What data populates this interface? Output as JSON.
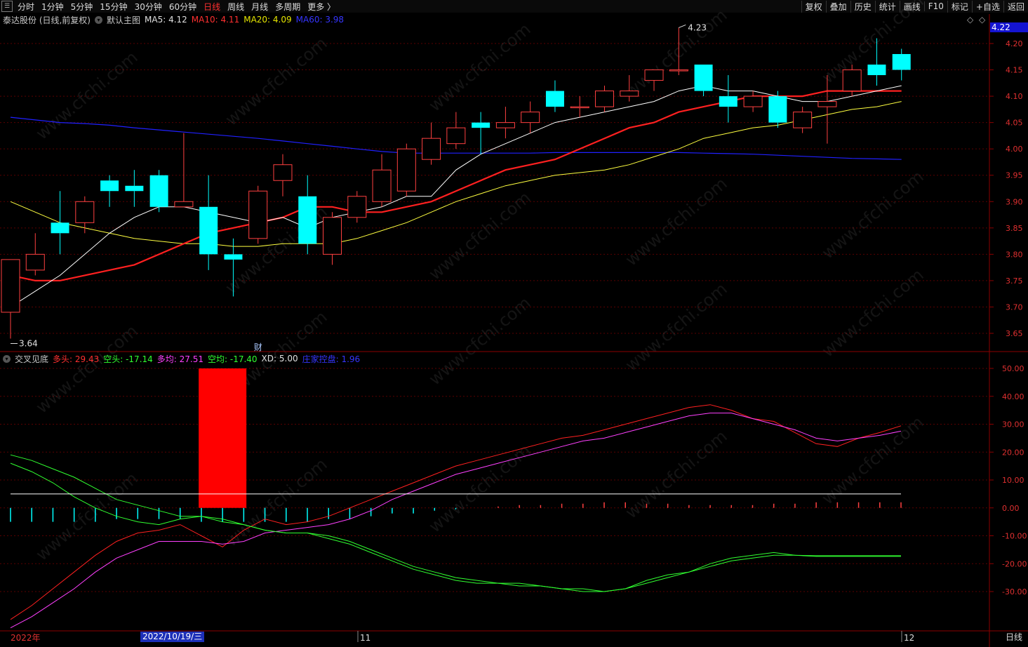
{
  "toolbar": {
    "left": [
      "分时",
      "1分钟",
      "5分钟",
      "15分钟",
      "30分钟",
      "60分钟",
      "日线",
      "周线",
      "月线",
      "多周期",
      "更多 〉"
    ],
    "active": "日线",
    "right": [
      "复权",
      "叠加",
      "历史",
      "统计",
      "画线",
      "F10",
      "标记",
      "+自选",
      "返回"
    ]
  },
  "main_legend": {
    "stock": "泰达股份 (日线,前复权)",
    "template": "默认主图",
    "ma5": "MA5: 4.12",
    "ma10": "MA10: 4.11",
    "ma20": "MA20: 4.09",
    "ma60": "MA60: 3.98"
  },
  "indicator_legend": {
    "name": "交叉见底",
    "duotou": "多头: 29.43",
    "kongtou": "空头: -17.14",
    "duojun": "多均: 27.51",
    "kongjun": "空均: -17.40",
    "xd": "XD: 5.00",
    "zhuang": "庄家控盘: 1.96"
  },
  "current_price": "4.22",
  "annotations": {
    "high": "4.23",
    "low": "3.64",
    "cai": "财"
  },
  "x_labels": {
    "year": "2022年",
    "month11": "11",
    "month12": "12"
  },
  "cursor_date": "2022/10/19/三",
  "bottom_right_button": "日线",
  "watermark": "www.cfchi.com",
  "colors": {
    "bg": "#000000",
    "up": "#ff4040",
    "down": "#00ffff",
    "ma5": "#ffffff",
    "ma10": "#ff2020",
    "ma20": "#ffff40",
    "ma60": "#2020ff",
    "duotou": "#ff2020",
    "kongtou": "#30ff30",
    "duojun": "#ff40ff",
    "kongjun": "#30ff30",
    "xd": "#ffffff",
    "bar": "#ff0000",
    "axis_red": "#8b0000"
  },
  "chart_data": [
    {
      "type": "candlestick",
      "title": "泰达股份 (日线,前复权)",
      "y_ticks": [
        3.65,
        3.7,
        3.75,
        3.8,
        3.85,
        3.9,
        3.95,
        4.0,
        4.05,
        4.1,
        4.15,
        4.2
      ],
      "ylim": [
        3.62,
        4.27
      ],
      "candles": [
        {
          "o": 3.69,
          "h": 3.79,
          "l": 3.64,
          "c": 3.79
        },
        {
          "o": 3.77,
          "h": 3.84,
          "l": 3.76,
          "c": 3.8
        },
        {
          "o": 3.86,
          "h": 3.92,
          "l": 3.8,
          "c": 3.84
        },
        {
          "o": 3.86,
          "h": 3.91,
          "l": 3.84,
          "c": 3.9
        },
        {
          "o": 3.94,
          "h": 3.95,
          "l": 3.89,
          "c": 3.92
        },
        {
          "o": 3.93,
          "h": 3.96,
          "l": 3.89,
          "c": 3.92
        },
        {
          "o": 3.95,
          "h": 3.96,
          "l": 3.88,
          "c": 3.89
        },
        {
          "o": 3.89,
          "h": 4.03,
          "l": 3.89,
          "c": 3.9
        },
        {
          "o": 3.89,
          "h": 3.95,
          "l": 3.77,
          "c": 3.8
        },
        {
          "o": 3.8,
          "h": 3.83,
          "l": 3.72,
          "c": 3.79
        },
        {
          "o": 3.83,
          "h": 3.93,
          "l": 3.82,
          "c": 3.92
        },
        {
          "o": 3.94,
          "h": 3.99,
          "l": 3.91,
          "c": 3.97
        },
        {
          "o": 3.91,
          "h": 3.95,
          "l": 3.8,
          "c": 3.82
        },
        {
          "o": 3.8,
          "h": 3.88,
          "l": 3.78,
          "c": 3.87
        },
        {
          "o": 3.87,
          "h": 3.92,
          "l": 3.86,
          "c": 3.91
        },
        {
          "o": 3.9,
          "h": 3.99,
          "l": 3.89,
          "c": 3.96
        },
        {
          "o": 3.92,
          "h": 4.01,
          "l": 3.91,
          "c": 4.0
        },
        {
          "o": 3.98,
          "h": 4.05,
          "l": 3.97,
          "c": 4.02
        },
        {
          "o": 4.01,
          "h": 4.07,
          "l": 4.0,
          "c": 4.04
        },
        {
          "o": 4.05,
          "h": 4.07,
          "l": 3.99,
          "c": 4.04
        },
        {
          "o": 4.04,
          "h": 4.08,
          "l": 4.02,
          "c": 4.05
        },
        {
          "o": 4.05,
          "h": 4.09,
          "l": 4.03,
          "c": 4.07
        },
        {
          "o": 4.11,
          "h": 4.13,
          "l": 4.07,
          "c": 4.08
        },
        {
          "o": 4.08,
          "h": 4.1,
          "l": 4.06,
          "c": 4.08
        },
        {
          "o": 4.08,
          "h": 4.12,
          "l": 4.07,
          "c": 4.11
        },
        {
          "o": 4.1,
          "h": 4.14,
          "l": 4.09,
          "c": 4.11
        },
        {
          "o": 4.13,
          "h": 4.15,
          "l": 4.11,
          "c": 4.15
        },
        {
          "o": 4.15,
          "h": 4.23,
          "l": 4.14,
          "c": 4.15
        },
        {
          "o": 4.16,
          "h": 4.16,
          "l": 4.1,
          "c": 4.11
        },
        {
          "o": 4.1,
          "h": 4.14,
          "l": 4.05,
          "c": 4.08
        },
        {
          "o": 4.08,
          "h": 4.11,
          "l": 4.07,
          "c": 4.1
        },
        {
          "o": 4.1,
          "h": 4.11,
          "l": 4.04,
          "c": 4.05
        },
        {
          "o": 4.04,
          "h": 4.08,
          "l": 4.03,
          "c": 4.07
        },
        {
          "o": 4.08,
          "h": 4.14,
          "l": 4.01,
          "c": 4.09
        },
        {
          "o": 4.11,
          "h": 4.16,
          "l": 4.1,
          "c": 4.15
        },
        {
          "o": 4.16,
          "h": 4.21,
          "l": 4.12,
          "c": 4.14
        },
        {
          "o": 4.18,
          "h": 4.19,
          "l": 4.13,
          "c": 4.15
        }
      ],
      "ma5": [
        3.7,
        3.73,
        3.76,
        3.8,
        3.84,
        3.87,
        3.89,
        3.89,
        3.88,
        3.87,
        3.86,
        3.87,
        3.85,
        3.87,
        3.88,
        3.89,
        3.91,
        3.91,
        3.96,
        3.99,
        4.01,
        4.03,
        4.05,
        4.06,
        4.07,
        4.08,
        4.09,
        4.11,
        4.12,
        4.11,
        4.11,
        4.1,
        4.09,
        4.09,
        4.1,
        4.11,
        4.12
      ],
      "ma10": [
        3.76,
        3.75,
        3.75,
        3.76,
        3.77,
        3.78,
        3.8,
        3.82,
        3.84,
        3.85,
        3.86,
        3.87,
        3.89,
        3.89,
        3.88,
        3.88,
        3.89,
        3.9,
        3.92,
        3.94,
        3.96,
        3.97,
        3.98,
        4.0,
        4.02,
        4.04,
        4.05,
        4.07,
        4.08,
        4.09,
        4.1,
        4.1,
        4.1,
        4.11,
        4.11,
        4.11,
        4.11
      ],
      "ma20": [
        3.9,
        3.88,
        3.86,
        3.85,
        3.84,
        3.83,
        3.825,
        3.82,
        3.82,
        3.815,
        3.815,
        3.82,
        3.82,
        3.82,
        3.83,
        3.845,
        3.86,
        3.88,
        3.9,
        3.915,
        3.93,
        3.94,
        3.95,
        3.955,
        3.96,
        3.97,
        3.985,
        4.0,
        4.02,
        4.03,
        4.04,
        4.045,
        4.055,
        4.065,
        4.075,
        4.08,
        4.09
      ],
      "ma60": [
        4.06,
        4.055,
        4.05,
        4.048,
        4.045,
        4.04,
        4.036,
        4.032,
        4.028,
        4.024,
        4.02,
        4.015,
        4.01,
        4.005,
        4.0,
        3.995,
        3.992,
        3.992,
        3.992,
        3.992,
        3.992,
        3.992,
        3.993,
        3.993,
        3.993,
        3.993,
        3.993,
        3.993,
        3.992,
        3.991,
        3.99,
        3.988,
        3.986,
        3.984,
        3.982,
        3.981,
        3.98
      ]
    },
    {
      "type": "line",
      "title": "交叉见底",
      "y_ticks": [
        50,
        40,
        30,
        20,
        10,
        0,
        -10,
        -20,
        -30
      ],
      "ylim": [
        -44,
        54
      ],
      "series": [
        {
          "name": "多头",
          "values": [
            -40,
            -35,
            -29,
            -23,
            -17,
            -12,
            -9,
            -8,
            -6,
            -10,
            -14,
            -8,
            -4,
            -6,
            -5,
            -3,
            0,
            3,
            6,
            9,
            12,
            15,
            17,
            19,
            21,
            23,
            25,
            26,
            28,
            30,
            32,
            34,
            36,
            37,
            35,
            32,
            31,
            27,
            23,
            22,
            25,
            27,
            29.43
          ]
        },
        {
          "name": "空头",
          "values": [
            16,
            13,
            9,
            4,
            0,
            -3,
            -5,
            -6,
            -4,
            -3,
            -5,
            -6,
            -8,
            -9,
            -9,
            -11,
            -13,
            -16,
            -19,
            -22,
            -24,
            -26,
            -27,
            -27,
            -28,
            -28,
            -29,
            -30,
            -30,
            -29,
            -26,
            -24,
            -23,
            -20,
            -18,
            -17,
            -16,
            -17,
            -17.14,
            -17.14,
            -17.14,
            -17.14,
            -17.14
          ]
        },
        {
          "name": "多均",
          "values": [
            -43,
            -39,
            -34,
            -29,
            -23,
            -18,
            -15,
            -12,
            -12,
            -12,
            -13,
            -12,
            -9,
            -8,
            -7,
            -6,
            -4,
            -1,
            3,
            6,
            9,
            12,
            14,
            16,
            18,
            20,
            22,
            24,
            25,
            27,
            29,
            31,
            33,
            34,
            34,
            32,
            30,
            28,
            25,
            24,
            25,
            26,
            27.51
          ]
        },
        {
          "name": "空均",
          "values": [
            19,
            17,
            14,
            11,
            7,
            3,
            1,
            -1,
            -3,
            -3,
            -4,
            -6,
            -8,
            -9,
            -9,
            -10,
            -12,
            -15,
            -18,
            -21,
            -23,
            -25,
            -26,
            -27,
            -27,
            -28,
            -29,
            -29,
            -30,
            -29,
            -27,
            -25,
            -23,
            -21,
            -19,
            -18,
            -17,
            -17,
            -17.4,
            -17.4,
            -17.4,
            -17.4,
            -17.4
          ]
        },
        {
          "name": "XD",
          "values": [
            5,
            5,
            5,
            5,
            5,
            5,
            5,
            5,
            5,
            5,
            5,
            5,
            5,
            5,
            5,
            5,
            5,
            5,
            5,
            5,
            5,
            5,
            5,
            5,
            5,
            5,
            5,
            5,
            5,
            5,
            5,
            5,
            5,
            5,
            5,
            5,
            5,
            5,
            5,
            5,
            5,
            5,
            5
          ]
        }
      ],
      "bar": {
        "index": 10,
        "value": 50
      },
      "ticks": [
        -5,
        -5,
        -5,
        -5,
        -5,
        -4,
        -4,
        -4,
        -4,
        -5,
        -5,
        -5,
        -5,
        -5,
        -5,
        -4,
        -4,
        -3,
        -2,
        -2,
        -1,
        -0.5,
        0,
        0.5,
        1,
        1,
        1.5,
        1.5,
        2,
        2,
        1.5,
        1.5,
        1,
        1,
        1,
        1,
        1.5,
        1.5,
        2,
        2,
        2,
        2,
        2
      ]
    }
  ]
}
